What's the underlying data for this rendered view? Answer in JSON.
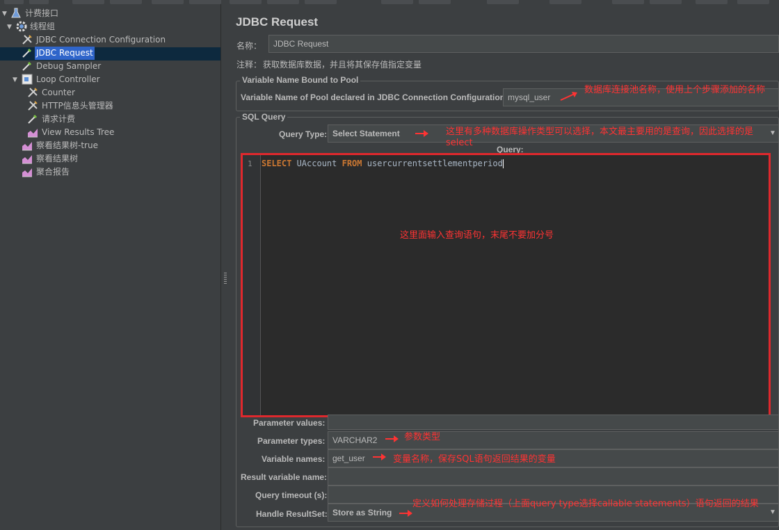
{
  "tree": {
    "nodes": [
      {
        "label": "计费接口",
        "level": 0,
        "icon": "test-plan-flask-icon",
        "expanded": true
      },
      {
        "label": "线程组",
        "level": 1,
        "icon": "thread-group-gear-icon",
        "expanded": true
      },
      {
        "label": "JDBC Connection Configuration",
        "level": 2,
        "icon": "config-element-wrench-icon"
      },
      {
        "label": "JDBC Request",
        "level": 2,
        "icon": "sampler-pipette-icon",
        "selected": true
      },
      {
        "label": "Debug Sampler",
        "level": 2,
        "icon": "sampler-pipette-icon"
      },
      {
        "label": "Loop Controller",
        "level": 2,
        "icon": "logic-controller-icon",
        "expanded": true
      },
      {
        "label": "Counter",
        "level": 3,
        "icon": "config-element-wrench-icon"
      },
      {
        "label": "HTTP信息头管理器",
        "level": 3,
        "icon": "config-element-wrench-icon"
      },
      {
        "label": "请求计费",
        "level": 3,
        "icon": "sampler-pipette-icon"
      },
      {
        "label": "View Results Tree",
        "level": 3,
        "icon": "listener-chart-icon"
      },
      {
        "label": "察看结果树-true",
        "level": 2,
        "icon": "listener-chart-icon"
      },
      {
        "label": "察看结果树",
        "level": 2,
        "icon": "listener-chart-icon"
      },
      {
        "label": "聚合报告",
        "level": 2,
        "icon": "listener-chart-icon"
      }
    ]
  },
  "main": {
    "title": "JDBC Request",
    "name_label": "名称：",
    "name_value": "JDBC Request",
    "comment_label": "注释：",
    "comment_value": "获取数据库数据，并且将其保存值指定变量",
    "pool_group": {
      "title": "Variable Name Bound to Pool",
      "label": "Variable Name of Pool declared in JDBC Connection Configuration:",
      "value": "mysql_user",
      "annotation": "数据库连接池名称，使用上个步骤添加的名称"
    },
    "sql_group": {
      "title": "SQL Query",
      "query_type_label": "Query Type:",
      "query_type_value": "Select Statement",
      "query_type_annotation": "这里有多种数据库操作类型可以选择，本文最主要用的是查询，因此选择的是select",
      "query_label": "Query:",
      "line_number": "1",
      "code_kw1": "SELECT",
      "code_mid": " UAccount ",
      "code_kw2": "FROM",
      "code_end": " usercurrentsettlementperiod",
      "editor_annotation": "这里面输入查询语句，末尾不要加分号"
    },
    "params": [
      {
        "label": "Parameter values:",
        "value": "",
        "annotation": ""
      },
      {
        "label": "Parameter types:",
        "value": "VARCHAR2",
        "annotation": "参数类型"
      },
      {
        "label": "Variable names:",
        "value": "get_user",
        "annotation": "变量名称，保存SQL语句返回结果的变量"
      },
      {
        "label": "Result variable name:",
        "value": "",
        "annotation": ""
      },
      {
        "label": "Query timeout (s):",
        "value": "",
        "annotation": ""
      },
      {
        "label": "Handle ResultSet:",
        "value": "Store as String",
        "annotation": "定义如何处理存储过程（上面query type选择callable statements）语句返回的结果"
      }
    ]
  },
  "colors": {
    "background": "#3c3f41",
    "selection": "#2f65ca",
    "annotation": "#ff3333",
    "highlight_box": "#e0282d",
    "editor_bg": "#2b2b2b",
    "keyword": "#cc7832"
  }
}
